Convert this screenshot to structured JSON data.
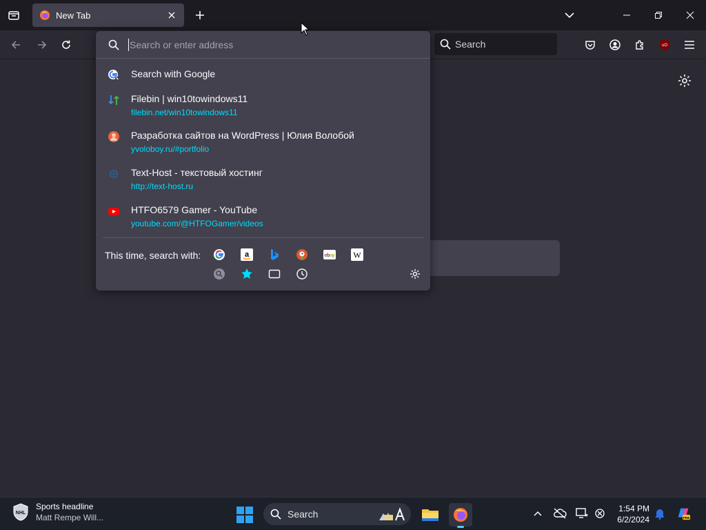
{
  "window": {
    "tab_title": "New Tab"
  },
  "navbar": {
    "search_label": "Search"
  },
  "urlbar": {
    "placeholder": "Search or enter address",
    "results": [
      {
        "title": "Search with Google",
        "url": "",
        "icon": "google-search-icon"
      },
      {
        "title": "Filebin | win10towindows11",
        "url": "filebin.net/win10towindows11",
        "icon": "filebin-favicon"
      },
      {
        "title": "Разработка сайтов на WordPress | Юлия Волобой",
        "url": "yvoloboy.ru/#portfolio",
        "icon": "yvoloboy-favicon"
      },
      {
        "title": "Text-Host - текстовый хостинг",
        "url": "http://text-host.ru",
        "icon": "text-host-favicon"
      },
      {
        "title": "HTFO6579 Gamer - YouTube",
        "url": "youtube.com/@HTFOGamer/videos",
        "icon": "youtube-favicon"
      }
    ],
    "oneoff_label": "This time, search with:",
    "engines": [
      "google",
      "amazon",
      "bing",
      "duckduckgo",
      "ebay",
      "wikipedia",
      "history-search",
      "bookmarks",
      "tabs",
      "history"
    ]
  },
  "taskbar": {
    "widget_title": "Sports headline",
    "widget_subtitle": "Matt Rempe Will...",
    "search_label": "Search",
    "time": "1:54 PM",
    "date": "6/2/2024"
  },
  "colors": {
    "accent": "#00ddff",
    "toolbar": "#2b2a33",
    "tabstrip": "#1c1b22",
    "popup": "#42414d"
  }
}
